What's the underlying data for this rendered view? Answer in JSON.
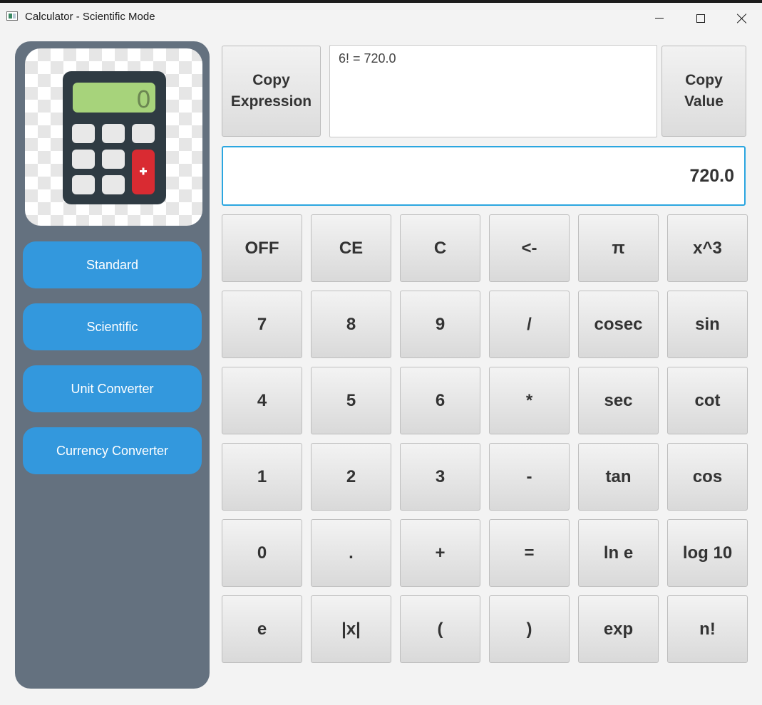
{
  "window": {
    "title": "Calculator - Scientific Mode",
    "icons": [
      "app-icon",
      "minimize-icon",
      "maximize-icon",
      "close-icon"
    ]
  },
  "sidebar": {
    "logo_icon": "calculator-icon",
    "logo_display": "0",
    "items": [
      {
        "label": "Standard"
      },
      {
        "label": "Scientific"
      },
      {
        "label": "Unit Converter"
      },
      {
        "label": "Currency Converter"
      }
    ]
  },
  "top": {
    "copy_expression": {
      "line1": "Copy",
      "line2": "Expression"
    },
    "copy_value": {
      "line1": "Copy",
      "line2": "Value"
    },
    "history": "6! = 720.0"
  },
  "display": {
    "value": "720.0"
  },
  "keys": [
    [
      "OFF",
      "CE",
      "C",
      "<-",
      "π",
      "x^3"
    ],
    [
      "7",
      "8",
      "9",
      "/",
      "cosec",
      "sin"
    ],
    [
      "4",
      "5",
      "6",
      "*",
      "sec",
      "cot"
    ],
    [
      "1",
      "2",
      "3",
      "-",
      "tan",
      "cos"
    ],
    [
      "0",
      ".",
      "+",
      "=",
      "ln e",
      "log 10"
    ],
    [
      "e",
      "|x|",
      "(",
      ")",
      "exp",
      "n!"
    ]
  ],
  "colors": {
    "sidebar": "#64717f",
    "nav_button": "#3398dd",
    "display_border": "#2ba6e0",
    "background": "#f3f3f3"
  }
}
